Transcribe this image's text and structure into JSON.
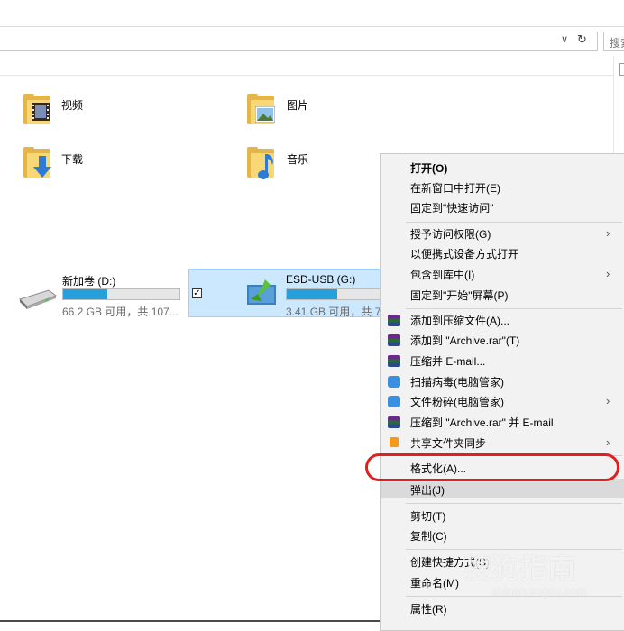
{
  "search": {
    "label": "搜索"
  },
  "folders": [
    {
      "name": "视频"
    },
    {
      "name": "图片"
    },
    {
      "name": "下载"
    },
    {
      "name": "音乐"
    }
  ],
  "drives": [
    {
      "name": "新加卷 (D:)",
      "free": "66.2 GB 可用，共 107...",
      "usage_fraction": 0.38
    },
    {
      "name": "ESD-USB (G:)",
      "free": "3.41 GB 可用，共 7",
      "usage_fraction": 0.5
    }
  ],
  "context_menu": {
    "items": [
      {
        "label": "打开(O)"
      },
      {
        "label": "在新窗口中打开(E)"
      },
      {
        "label": "固定到\"快速访问\""
      },
      {
        "label": "授予访问权限(G)"
      },
      {
        "label": "以便携式设备方式打开"
      },
      {
        "label": "包含到库中(I)"
      },
      {
        "label": "固定到\"开始\"屏幕(P)"
      },
      {
        "label": "添加到压缩文件(A)..."
      },
      {
        "label": "添加到 \"Archive.rar\"(T)"
      },
      {
        "label": "压缩并 E-mail..."
      },
      {
        "label": "扫描病毒(电脑管家)"
      },
      {
        "label": "文件粉碎(电脑管家)"
      },
      {
        "label": "压缩到 \"Archive.rar\" 并 E-mail"
      },
      {
        "label": "共享文件夹同步"
      },
      {
        "label": "格式化(A)..."
      },
      {
        "label": "弹出(J)"
      },
      {
        "label": "剪切(T)"
      },
      {
        "label": "复制(C)"
      },
      {
        "label": "创建快捷方式(S)"
      },
      {
        "label": "重命名(M)"
      },
      {
        "label": "属性(R)"
      }
    ],
    "submenu_arrow": "›"
  },
  "watermark": {
    "main": "搜狗指南",
    "url": "zhinan.sogou.com"
  },
  "colors": {
    "highlight_oval": "#e02020",
    "drive_bar": "#26a0da",
    "selection": "#cce8ff"
  }
}
